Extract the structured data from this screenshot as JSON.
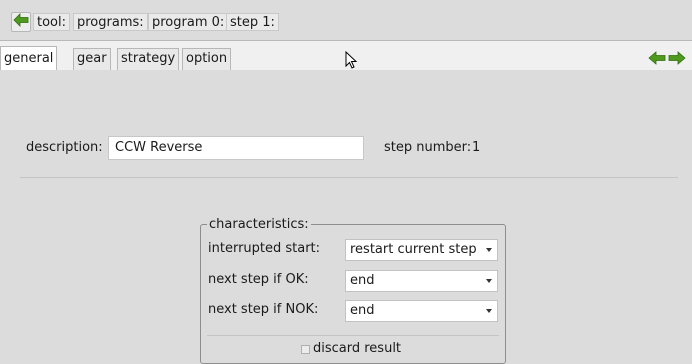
{
  "breadcrumb": {
    "items": [
      "tool:",
      "programs:",
      "program 0:",
      "step 1:"
    ]
  },
  "tabs": [
    "general",
    "gear",
    "strategy",
    "option"
  ],
  "active_tab": "general",
  "general": {
    "description_label": "description:",
    "description_value": "CCW Reverse",
    "step_number_label": "step number:",
    "step_number_value": "1"
  },
  "characteristics": {
    "title": "characteristics:",
    "interrupted_start_label": "interrupted start:",
    "interrupted_start_value": "restart current step",
    "next_ok_label": "next step if OK:",
    "next_ok_value": "end",
    "next_nok_label": "next step if NOK:",
    "next_nok_value": "end",
    "discard_label": "discard result",
    "discard_checked": false
  },
  "icons": {
    "back": "back-arrow-icon",
    "prev": "left-arrow-icon",
    "next": "right-arrow-icon",
    "cursor": "mouse-cursor-icon"
  },
  "colors": {
    "arrow_green": "#4f9a1e",
    "background": "#dcdcdc",
    "tabbar": "#f0f0f0"
  }
}
